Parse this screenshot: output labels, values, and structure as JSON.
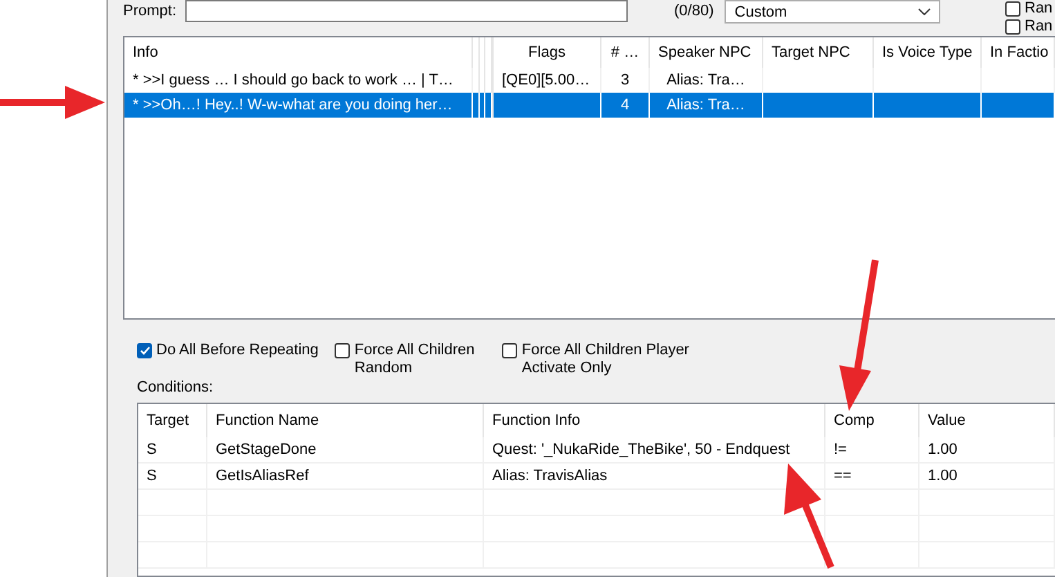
{
  "prompt": {
    "label": "Prompt:",
    "counter": "(0/80)",
    "dropdown": "Custom"
  },
  "corner_checkboxes": [
    {
      "label": "Ran",
      "checked": false
    },
    {
      "label": "Ran",
      "checked": false
    }
  ],
  "info_table": {
    "columns": [
      "Info",
      "Flags",
      "# …",
      "Speaker NPC",
      "Target NPC",
      "Is Voice Type",
      "In Factio"
    ],
    "rows": [
      {
        "info": "* >>I guess … I should go back to work … | T…",
        "flags": "[QE0][5.00…",
        "number": "3",
        "speaker_npc": "Alias: Tra…",
        "selected": false
      },
      {
        "info": "* >>Oh…! Hey..! W-w-what are you doing her…",
        "number": "4",
        "speaker_npc": "Alias: Tra…",
        "selected": true
      }
    ]
  },
  "options": [
    {
      "label": "Do All Before Repeating",
      "checked": true
    },
    {
      "label": "Force All Children Random",
      "checked": false
    },
    {
      "label": "Force All Children Player Activate Only",
      "checked": false
    }
  ],
  "conditions": {
    "label": "Conditions:",
    "columns": [
      "Target",
      "Function Name",
      "Function Info",
      "Comp",
      "Value"
    ],
    "rows": [
      [
        "S",
        "GetStageDone",
        "Quest: '_NukaRide_TheBike', 50 - Endquest",
        "!=",
        "1.00"
      ],
      [
        "S",
        "GetIsAliasRef",
        "Alias: TravisAlias",
        "==",
        "1.00"
      ]
    ]
  }
}
